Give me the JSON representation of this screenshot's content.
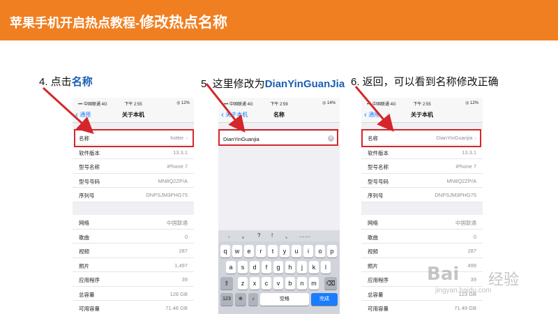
{
  "banner": {
    "title_prefix": "苹果手机开启热点教程-",
    "title_main": "修改热点名称"
  },
  "steps": [
    {
      "prefix": "4. 点击",
      "highlight": "名称",
      "suffix": ""
    },
    {
      "prefix": "5. 这里修改为",
      "highlight": "DianYinGuanJia",
      "suffix": ""
    },
    {
      "prefix": "6. 返回，可以看到名称修改正确",
      "highlight": "",
      "suffix": ""
    }
  ],
  "phone1": {
    "status": {
      "carrier": "••• 中国联通  4G",
      "time": "下午 2:55",
      "battery": "◎ 12%"
    },
    "nav": {
      "back": "通用",
      "title": "关于本机"
    },
    "rows": [
      {
        "label": "名称",
        "value": "hotter",
        "arrow": "›"
      },
      {
        "label": "软件版本",
        "value": "13.3.1",
        "arrow": ""
      },
      {
        "label": "型号名称",
        "value": "iPhone 7",
        "arrow": ""
      },
      {
        "label": "型号号码",
        "value": "MN8Q2ZP/A",
        "arrow": ""
      },
      {
        "label": "序列号",
        "value": "DNPSJM3PHG75",
        "arrow": ""
      }
    ],
    "rows2": [
      {
        "label": "网络",
        "value": "中国联通"
      },
      {
        "label": "歌曲",
        "value": "0"
      },
      {
        "label": "视频",
        "value": "287"
      },
      {
        "label": "照片",
        "value": "1,497"
      },
      {
        "label": "应用程序",
        "value": "39"
      },
      {
        "label": "总容量",
        "value": "128 GB"
      },
      {
        "label": "可用容量",
        "value": "71.48 GB"
      }
    ]
  },
  "phone2": {
    "status": {
      "carrier": "••• 中国联通  4G",
      "time": "下午 2:59",
      "battery": "◎ 14%"
    },
    "nav": {
      "back": "关于本机",
      "title": "名称"
    },
    "input_value": "DianYinGuanjia",
    "suggestions": [
      ",",
      "。",
      "?",
      "!",
      "、",
      "……"
    ],
    "keys_row1": [
      "q",
      "w",
      "e",
      "r",
      "t",
      "y",
      "u",
      "i",
      "o",
      "p"
    ],
    "keys_row2": [
      "a",
      "s",
      "d",
      "f",
      "g",
      "h",
      "j",
      "k",
      "l"
    ],
    "keys_row3": [
      "z",
      "x",
      "c",
      "v",
      "b",
      "n",
      "m"
    ],
    "key_numbers": "123",
    "key_space": "空格",
    "key_done": "完成"
  },
  "phone3": {
    "status": {
      "carrier": "••• 中国联通  4G",
      "time": "下午 2:55",
      "battery": "◎ 12%"
    },
    "nav": {
      "back": "通用",
      "title": "关于本机"
    },
    "rows": [
      {
        "label": "名称",
        "value": "DianYinGuanjia",
        "arrow": "›"
      },
      {
        "label": "软件版本",
        "value": "13.3.1",
        "arrow": ""
      },
      {
        "label": "型号名称",
        "value": "iPhone 7",
        "arrow": ""
      },
      {
        "label": "型号号码",
        "value": "MN8Q2ZP/A",
        "arrow": ""
      },
      {
        "label": "序列号",
        "value": "DNPSJM3PHG75",
        "arrow": ""
      }
    ],
    "rows2": [
      {
        "label": "网络",
        "value": "中国联通"
      },
      {
        "label": "歌曲",
        "value": "0"
      },
      {
        "label": "视频",
        "value": "287"
      },
      {
        "label": "照片",
        "value": "499"
      },
      {
        "label": "应用程序",
        "value": "39"
      },
      {
        "label": "总容量",
        "value": "123 GB"
      },
      {
        "label": "可用容量",
        "value": "71.49 GB"
      }
    ]
  },
  "watermark": {
    "brand": "Bai",
    "suffix": "经验",
    "url": "jingyan.baidu.com"
  },
  "accent": {
    "banner": "#f07f21",
    "highlight": "#d4262b",
    "link": "#1a7cff"
  }
}
